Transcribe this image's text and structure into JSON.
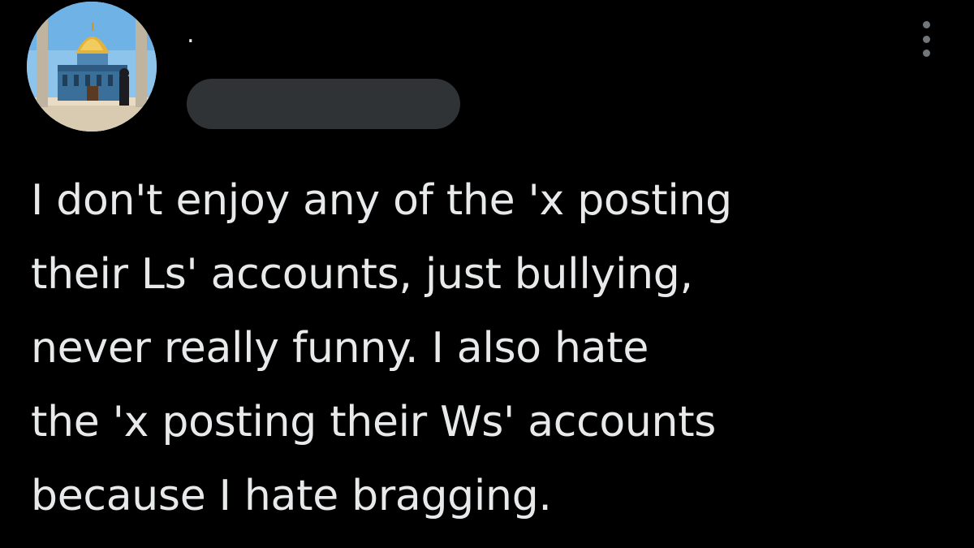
{
  "post": {
    "author": {
      "display_name": ".",
      "avatar_icon": "dome-of-the-rock-avatar",
      "handle_redacted": true
    },
    "menu_icon": "more-vertical-icon",
    "text": "I don't enjoy any of the 'x posting\ntheir Ls' accounts, just bullying,\nnever really funny. I also hate\nthe 'x posting their Ws' accounts\nbecause I hate bragging."
  },
  "colors": {
    "background": "#000000",
    "text": "#e7e9ea",
    "redaction": "#2f3336",
    "muted": "#71767b"
  }
}
